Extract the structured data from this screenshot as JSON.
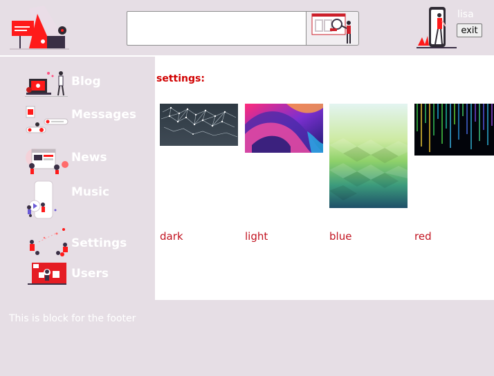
{
  "header": {
    "search": {
      "value": "",
      "placeholder": ""
    },
    "user": {
      "name": "lisa",
      "exit_label": "exit"
    }
  },
  "sidebar": {
    "items": [
      {
        "label": "Blog"
      },
      {
        "label": "Messages"
      },
      {
        "label": "News"
      },
      {
        "label": "Music"
      },
      {
        "label": "Settings"
      },
      {
        "label": "Users"
      }
    ]
  },
  "main": {
    "title": "settings:",
    "themes": [
      {
        "label": "dark"
      },
      {
        "label": "light"
      },
      {
        "label": "blue"
      },
      {
        "label": "red"
      }
    ]
  },
  "footer": {
    "text": "This is block for the footer"
  },
  "colors": {
    "accent": "#d10000",
    "background": "#e6dee5",
    "panel": "#ffffff"
  }
}
